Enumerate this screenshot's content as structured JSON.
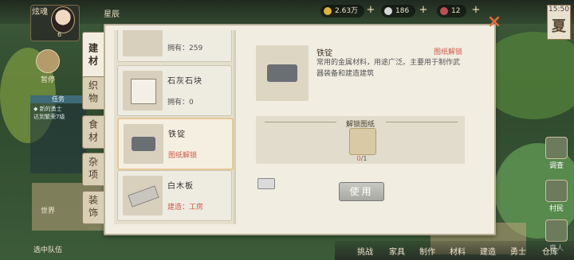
{
  "hud": {
    "player_name": "炫魂",
    "player_level": "6",
    "location": "星辰",
    "resources": [
      {
        "value": "2.63万",
        "color": "#e0b040"
      },
      {
        "value": "186",
        "color": "#d6d6d6"
      },
      {
        "value": "12",
        "color": "#c05050"
      }
    ],
    "plus": "+",
    "season_time": "15:50",
    "season": "夏",
    "left_quick": [
      "暂停",
      "任务"
    ],
    "task_title": "任务",
    "task_text": "◆ 新的勇士\n达到繁荣7级",
    "left_bottom": [
      "世界",
      "选中队伍"
    ],
    "right_quick": [
      "调查",
      "村民",
      "商人"
    ],
    "bottom_bar": [
      "挑战",
      "家具",
      "制作",
      "材料",
      "建造",
      "勇士",
      "仓库"
    ]
  },
  "dialog": {
    "close_label": "×",
    "tabs": [
      "建材",
      "织物",
      "食材",
      "杂项",
      "装饰"
    ],
    "active_tab": "建材",
    "items": [
      {
        "name": "",
        "meta": "拥有：259",
        "meta_red": false
      },
      {
        "name": "石灰石块",
        "meta": "拥有：0",
        "meta_red": false
      },
      {
        "name": "铁锭",
        "meta": "图纸解锁",
        "meta_red": true
      },
      {
        "name": "白木板",
        "meta": "建造：工房",
        "meta_red": true
      }
    ],
    "detail": {
      "name": "铁锭",
      "unlock_label": "图纸解锁",
      "description": "常用的金属材料，用途广泛。主要用于制作武器装备和建造建筑",
      "blueprint_title": "解锁图纸",
      "blueprint_have": "0",
      "blueprint_need": "/1",
      "use_button": "使用"
    }
  }
}
